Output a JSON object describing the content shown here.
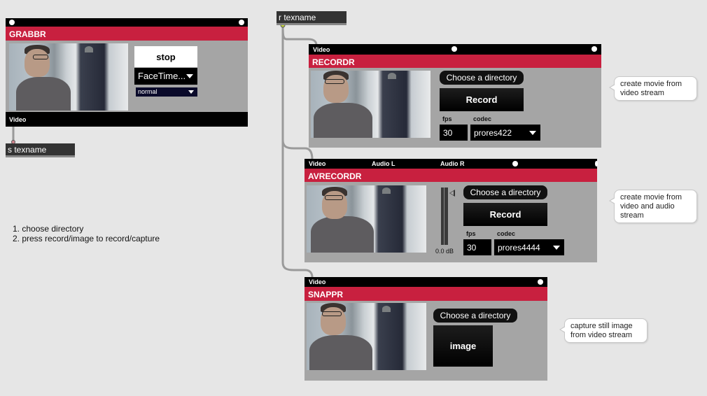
{
  "objects": {
    "receive": "r texname",
    "send": "s texname"
  },
  "grabbr": {
    "title": "GRABBR",
    "stop_label": "stop",
    "device": "FaceTime...",
    "mode": "normal",
    "outlet_label": "Video"
  },
  "recordr": {
    "inlet_label": "Video",
    "title": "RECORDR",
    "choose_dir": "Choose a directory",
    "record": "Record",
    "fps_label": "fps",
    "codec_label": "codec",
    "fps": "30",
    "codec": "prores422",
    "comment_line1": "create movie from",
    "comment_line2": "video stream"
  },
  "avrecordr": {
    "inlet_video": "Video",
    "inlet_audio_l": "Audio L",
    "inlet_audio_r": "Audio R",
    "title": "AVRECORDR",
    "choose_dir": "Choose a directory",
    "record": "Record",
    "fps_label": "fps",
    "codec_label": "codec",
    "fps": "30",
    "codec": "prores4444",
    "meter_db": "0.0 dB",
    "comment_line1": "create movie from",
    "comment_line2": "video and audio",
    "comment_line3": "stream"
  },
  "snappr": {
    "inlet_label": "Video",
    "title": "SNAPPR",
    "choose_dir": "Choose a directory",
    "image_button": "image",
    "comment_line1": "capture still image",
    "comment_line2": "from video stream"
  },
  "instructions": {
    "line1": "1. choose directory",
    "line2": "2. press record/image to record/capture"
  }
}
